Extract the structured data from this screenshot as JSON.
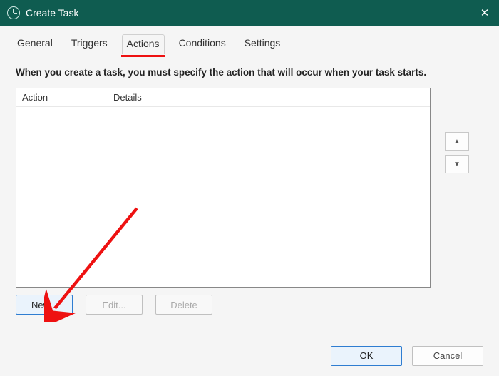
{
  "window": {
    "title": "Create Task",
    "close_symbol": "✕"
  },
  "tabs": {
    "general": "General",
    "triggers": "Triggers",
    "actions": "Actions",
    "conditions": "Conditions",
    "settings": "Settings"
  },
  "panel": {
    "description": "When you create a task, you must specify the action that will occur when your task starts.",
    "col_action": "Action",
    "col_details": "Details",
    "arrow_up": "▲",
    "arrow_down": "▼"
  },
  "buttons": {
    "new": "New...",
    "edit": "Edit...",
    "delete": "Delete",
    "ok": "OK",
    "cancel": "Cancel"
  }
}
